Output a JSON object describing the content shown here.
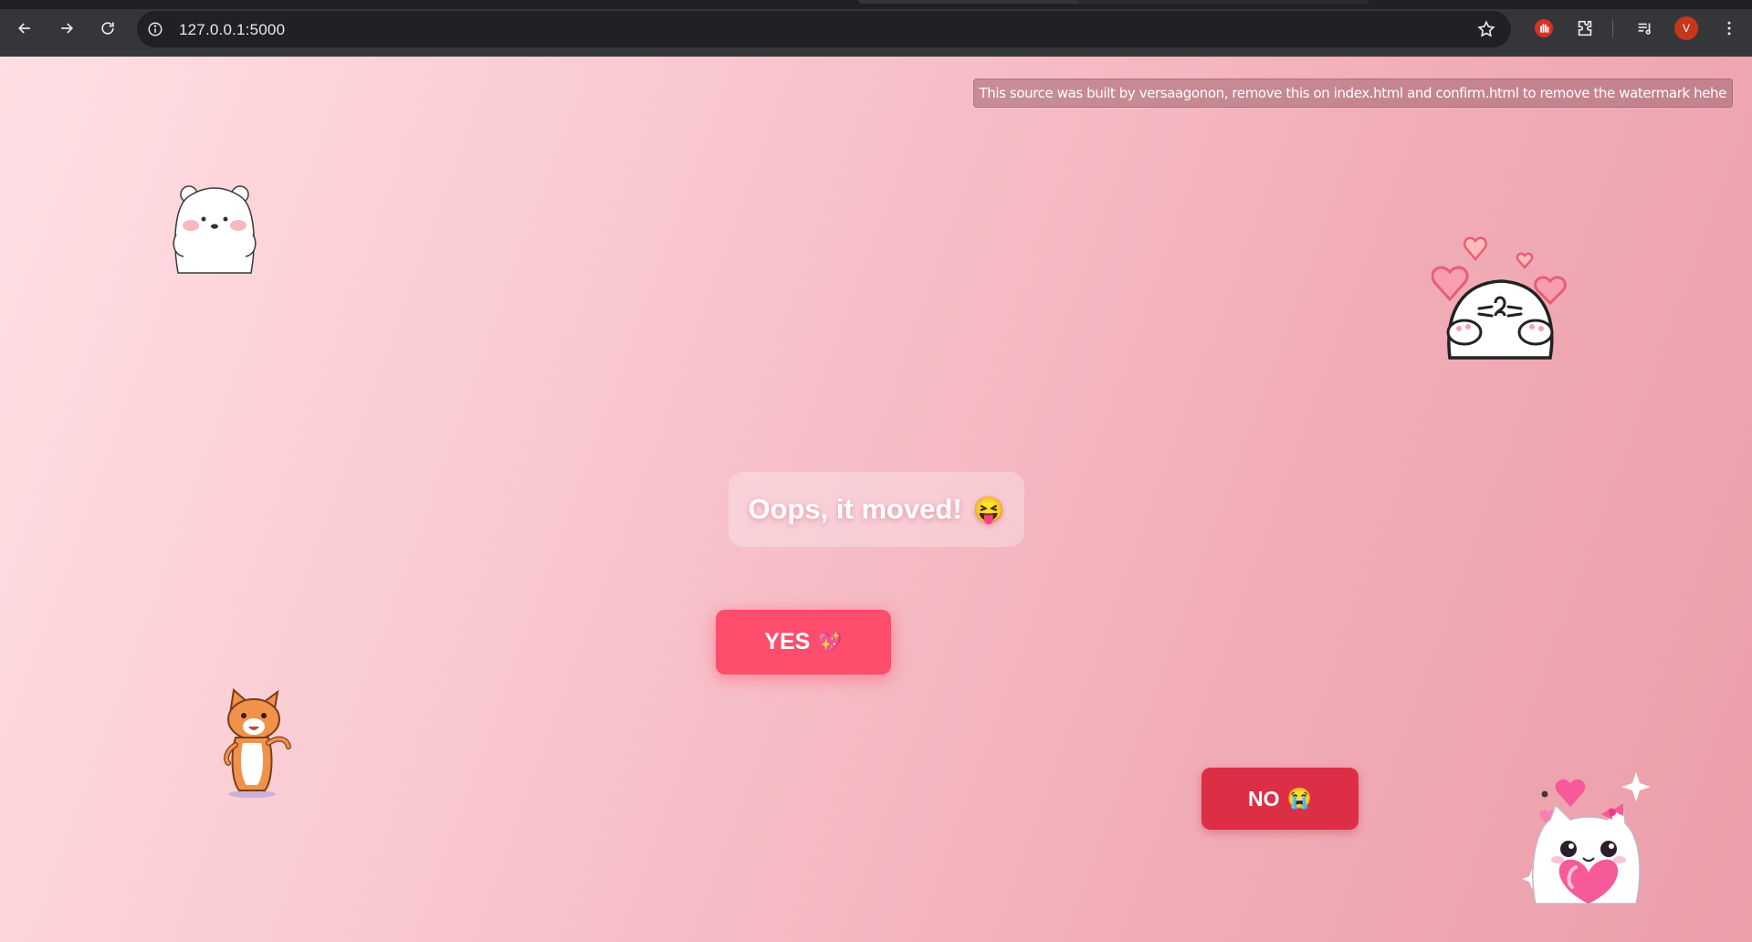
{
  "browser": {
    "url": "127.0.0.1:5000",
    "avatar_letter": "V"
  },
  "page": {
    "watermark": "This source was built by versaagonon, remove this on index.html and confirm.html to remove the watermark hehe",
    "message": "Oops, it moved!",
    "message_emoji": "😝",
    "yes_label": "YES",
    "yes_emoji": "💖",
    "no_label": "NO",
    "no_emoji": "😭",
    "colors": {
      "yes_button": "#ff4d6d",
      "no_button": "#dc2f45",
      "background_start": "#ffdfe3",
      "background_end": "#ec9ea9"
    },
    "stickers": [
      "white-bear-sticker",
      "heart-cat-sticker",
      "orange-cat-sticker",
      "pink-bow-cat-sticker"
    ]
  }
}
